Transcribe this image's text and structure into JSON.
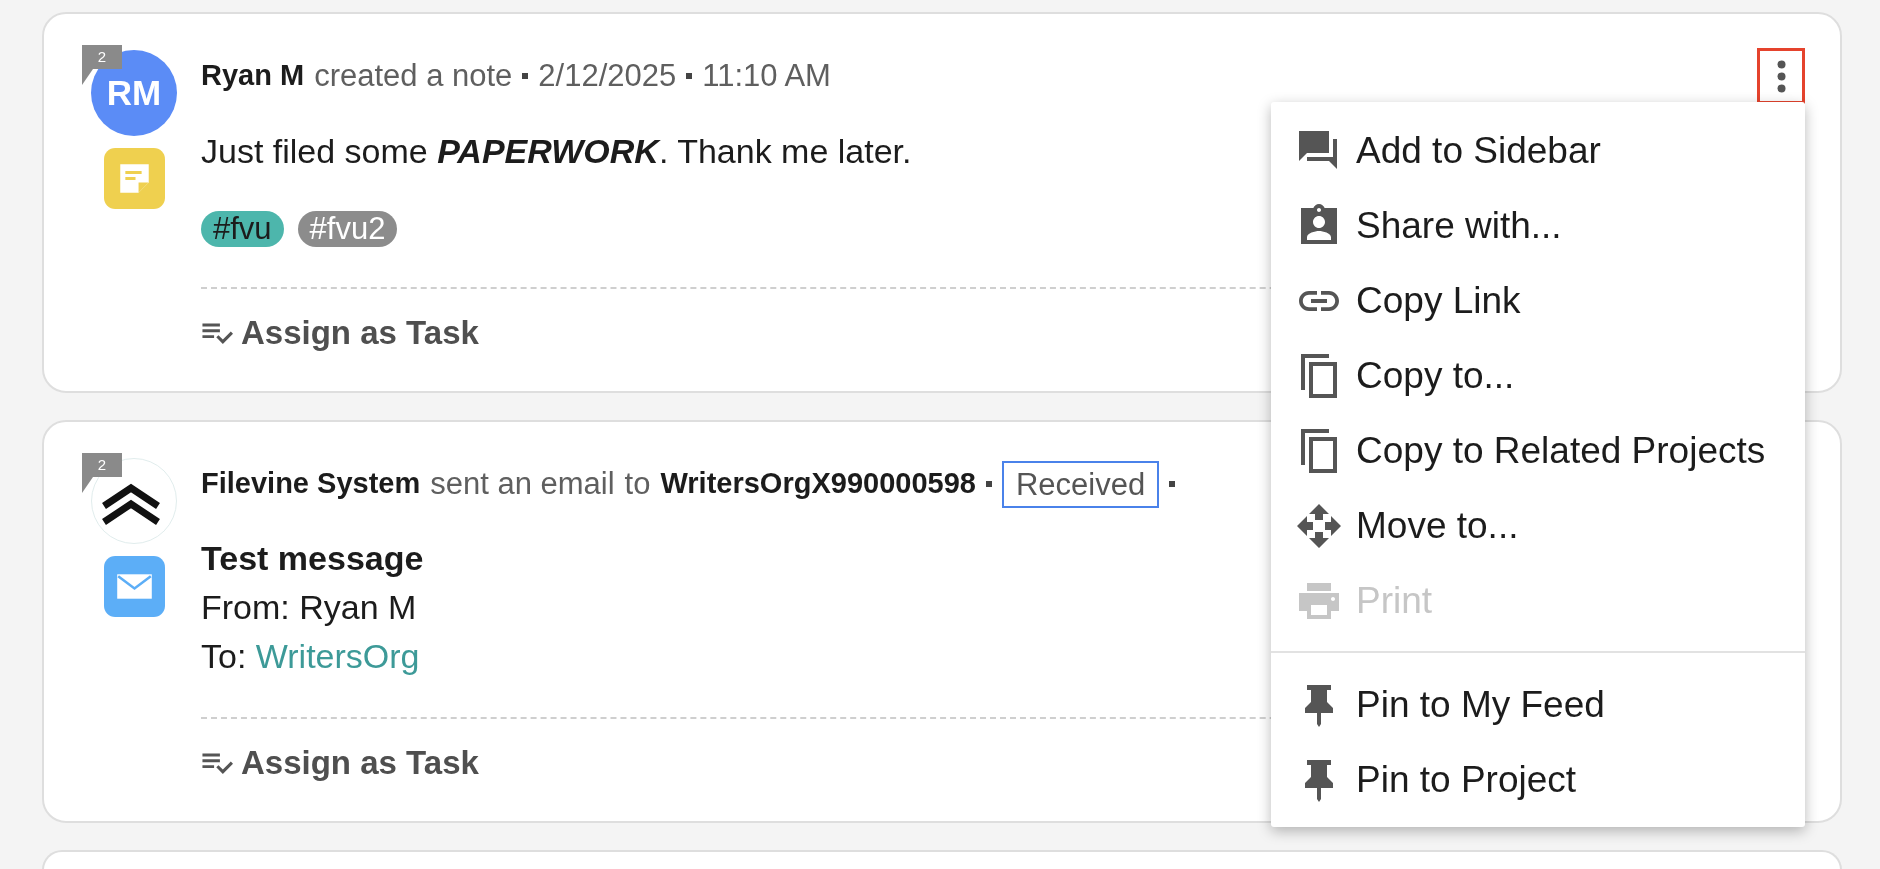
{
  "feed": [
    {
      "kind": "note",
      "comment_count": "2",
      "avatar": {
        "kind": "initials",
        "text": "RM"
      },
      "author": "Ryan M",
      "action": "created a note",
      "date": "2/12/2025",
      "time": "11:10 AM",
      "more_button": {
        "highlighted": true
      },
      "body": "Just filed some **PAPERWORK**. Thank me later.",
      "tags": [
        {
          "label": "#fvu",
          "color": "#4db6ac"
        },
        {
          "label": "#fvu2",
          "color": "#8c8c8c"
        }
      ],
      "task_link": "Assign as Task"
    },
    {
      "kind": "email",
      "comment_count": "2",
      "avatar": {
        "kind": "logo"
      },
      "author": "Filevine System",
      "action": "sent an email",
      "connector": "to",
      "recipient": "WritersOrgX990000598",
      "status": "Received",
      "preview": {
        "subject": "Test message",
        "from_line": "From: Ryan M",
        "to_label": "To:",
        "to_link": "WritersOrg"
      },
      "task_link": "Assign as Task"
    },
    {
      "kind": "partial"
    }
  ],
  "menu": {
    "sections": [
      {
        "items": [
          {
            "label": "Add to Sidebar",
            "disabled": false
          },
          {
            "label": "Share with...",
            "disabled": false
          },
          {
            "label": "Copy Link",
            "disabled": false
          },
          {
            "label": "Copy to...",
            "disabled": false
          },
          {
            "label": "Copy to Related Projects",
            "disabled": false
          },
          {
            "label": "Move to...",
            "disabled": false
          },
          {
            "label": "Print",
            "disabled": true
          }
        ]
      },
      {
        "items": [
          {
            "label": "Pin to My Feed",
            "disabled": false
          },
          {
            "label": "Pin to Project",
            "disabled": false
          }
        ]
      }
    ]
  }
}
